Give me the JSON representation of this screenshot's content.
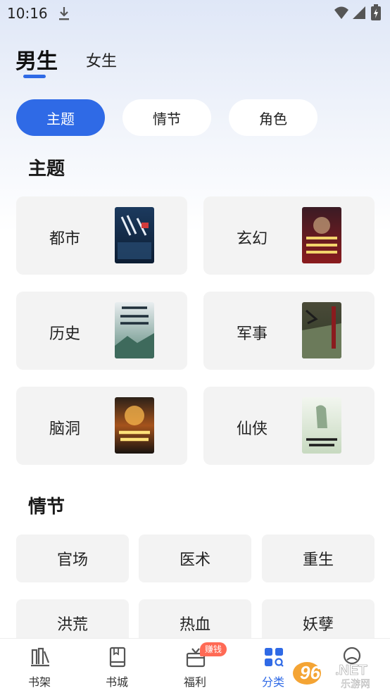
{
  "status_bar": {
    "time": "10:16"
  },
  "gender_tabs": {
    "active": "男生",
    "inactive": "女生"
  },
  "filters": {
    "items": [
      "主题",
      "情节",
      "角色"
    ],
    "selected": "主题"
  },
  "theme_section": {
    "title": "主题",
    "cards": [
      {
        "label": "都市",
        "cover_title": "执掌"
      },
      {
        "label": "玄幻",
        "cover_title": "我的徒弟居然是女帝"
      },
      {
        "label": "历史",
        "cover_title": "逍遥小地主"
      },
      {
        "label": "军事",
        "cover_title": ""
      },
      {
        "label": "脑洞",
        "cover_title": "我能修改万物时间"
      },
      {
        "label": "仙侠",
        "cover_title": "财迷仙途"
      }
    ]
  },
  "plot_section": {
    "title": "情节",
    "tags": [
      "官场",
      "医术",
      "重生",
      "洪荒",
      "热血",
      "妖孽"
    ]
  },
  "bottom_nav": {
    "items": [
      {
        "label": "书架",
        "icon": "bookshelf-icon"
      },
      {
        "label": "书城",
        "icon": "book-icon"
      },
      {
        "label": "福利",
        "icon": "gift-icon",
        "badge": "赚钱"
      },
      {
        "label": "分类",
        "icon": "category-icon",
        "active": true
      },
      {
        "label": "",
        "icon": "profile-icon"
      }
    ]
  },
  "watermark": {
    "text": "962.NET",
    "subtext": "乐游网"
  },
  "colors": {
    "accent": "#2f6ae6",
    "card_bg": "#f3f3f3",
    "badge": "#ff6a55"
  }
}
